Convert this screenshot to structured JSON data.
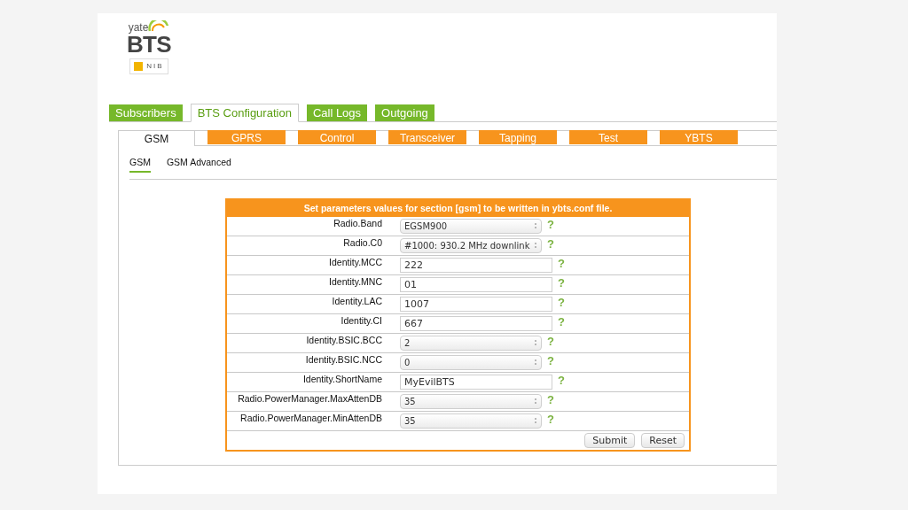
{
  "logo": {
    "top": "yate",
    "main": "BTS",
    "badge": "NIB"
  },
  "main_tabs": [
    {
      "label": "Subscribers",
      "selected": false
    },
    {
      "label": "BTS Configuration",
      "selected": true
    },
    {
      "label": "Call Logs",
      "selected": false
    },
    {
      "label": "Outgoing",
      "selected": false
    }
  ],
  "section_tabs": [
    {
      "label": "GSM",
      "selected": true
    },
    {
      "label": "GPRS",
      "selected": false
    },
    {
      "label": "Control",
      "selected": false
    },
    {
      "label": "Transceiver",
      "selected": false
    },
    {
      "label": "Tapping",
      "selected": false
    },
    {
      "label": "Test",
      "selected": false
    },
    {
      "label": "YBTS",
      "selected": false
    }
  ],
  "sub_tabs": [
    {
      "label": "GSM",
      "selected": true
    },
    {
      "label": "GSM Advanced",
      "selected": false
    }
  ],
  "form": {
    "title": "Set parameters values for section [gsm] to be written in ybts.conf file.",
    "fields": [
      {
        "label": "Radio.Band",
        "kind": "select",
        "value": "EGSM900",
        "help": "?"
      },
      {
        "label": "Radio.C0",
        "kind": "select",
        "value": "#1000: 930.2 MHz downlink",
        "help": "?"
      },
      {
        "label": "Identity.MCC",
        "kind": "text",
        "value": "222",
        "help": "?"
      },
      {
        "label": "Identity.MNC",
        "kind": "text",
        "value": "01",
        "help": "?"
      },
      {
        "label": "Identity.LAC",
        "kind": "text",
        "value": "1007",
        "help": "?"
      },
      {
        "label": "Identity.CI",
        "kind": "text",
        "value": "667",
        "help": "?"
      },
      {
        "label": "Identity.BSIC.BCC",
        "kind": "select",
        "value": "2",
        "help": "?"
      },
      {
        "label": "Identity.BSIC.NCC",
        "kind": "select",
        "value": "0",
        "help": "?"
      },
      {
        "label": "Identity.ShortName",
        "kind": "text",
        "value": "MyEvilBTS",
        "help": "?"
      },
      {
        "label": "Radio.PowerManager.MaxAttenDB",
        "kind": "select",
        "value": "35",
        "help": "?"
      },
      {
        "label": "Radio.PowerManager.MinAttenDB",
        "kind": "select",
        "value": "35",
        "help": "?"
      }
    ],
    "buttons": [
      "Submit",
      "Reset"
    ]
  }
}
